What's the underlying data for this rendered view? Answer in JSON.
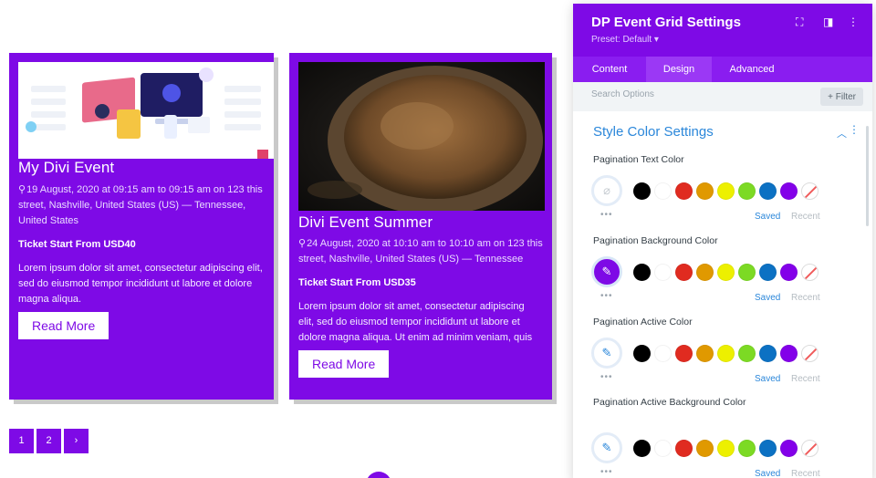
{
  "cards": [
    {
      "title": "My Divi Event",
      "meta": "19 August, 2020 at 09:15 am to 09:15 am on 123 this street, Nashville, United States (US) — Tennessee, United States",
      "ticket": "Ticket Start From USD40",
      "desc": "Lorem ipsum dolor sit amet, consectetur adipiscing elit, sed do eiusmod tempor incididunt ut labore et dolore magna aliqua.",
      "button": "Read More"
    },
    {
      "title": "Divi Event Summer",
      "meta": "24 August, 2020 at 10:10 am to 10:10 am on 123 this street, Nashville, United States (US) — Tennessee",
      "ticket": "Ticket Start From USD35",
      "desc": "Lorem ipsum dolor sit amet, consectetur adipiscing elit, sed do eiusmod tempor incididunt ut labore et dolore magna aliqua. Ut enim ad minim veniam, quis",
      "button": "Read More"
    }
  ],
  "pagination": {
    "items": [
      "1",
      "2",
      "›"
    ]
  },
  "panel": {
    "title": "DP Event Grid Settings",
    "preset": "Preset: Default ▾",
    "tabs": [
      "Content",
      "Design",
      "Advanced"
    ],
    "active_tab": "Design",
    "search_placeholder": "Search Options",
    "filter_label": "+ Filter",
    "section_title": "Style Color Settings",
    "settings": [
      {
        "label": "Pagination Text Color",
        "saved": "Saved",
        "recent": "Recent"
      },
      {
        "label": "Pagination Background Color",
        "saved": "Saved",
        "recent": "Recent"
      },
      {
        "label": "Pagination Active Color",
        "saved": "Saved",
        "recent": "Recent"
      },
      {
        "label": "Pagination Active Background Color",
        "saved": "Saved",
        "recent": "Recent"
      }
    ],
    "swatch_colors": [
      "#000000",
      "#ffffff",
      "#e02b20",
      "#e09900",
      "#edf000",
      "#7cda24",
      "#0c71c3",
      "#8300e9"
    ]
  },
  "colors": {
    "accent": "#7e0ae6",
    "link": "#2b87da"
  }
}
